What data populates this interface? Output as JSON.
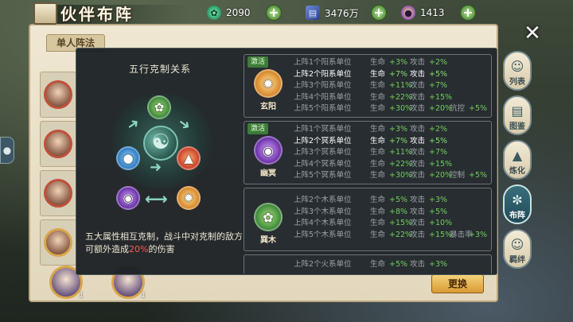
{
  "header": {
    "title": "伙伴布阵",
    "resources": [
      {
        "icon": "jade-icon",
        "value": "2090"
      },
      {
        "icon": "book-icon",
        "value": "3476万"
      },
      {
        "icon": "orb-icon",
        "value": "1413"
      }
    ]
  },
  "panel": {
    "tab_label": "单人阵法",
    "swap_button": "更换",
    "bottom_levels": [
      "1",
      "1"
    ]
  },
  "side_menu": [
    {
      "label": "列表",
      "icon": "list-icon"
    },
    {
      "label": "图鉴",
      "icon": "album-icon"
    },
    {
      "label": "炼化",
      "icon": "furnace-icon"
    },
    {
      "label": "布阵",
      "icon": "formation-icon",
      "active": true
    },
    {
      "label": "羁绊",
      "icon": "bond-icon"
    }
  ],
  "wheel": {
    "title": "五行克制关系",
    "desc_prefix": "五大属性相互克制，战斗中对克制的敌方可额外造成",
    "desc_highlight": "20%",
    "desc_suffix": "的伤害"
  },
  "cards": [
    {
      "badge": "激活",
      "name": "玄阳",
      "rows": [
        {
          "cond": "上阵1个阳系单位",
          "a_k": "生命",
          "a_v": "+3%",
          "b_k": "攻击",
          "b_v": "+2%",
          "c_k": "",
          "c_v": ""
        },
        {
          "cond": "上阵2个阳系单位",
          "a_k": "生命",
          "a_v": "+7%",
          "b_k": "攻击",
          "b_v": "+5%",
          "c_k": "",
          "c_v": "",
          "current": true
        },
        {
          "cond": "上阵3个阳系单位",
          "a_k": "生命",
          "a_v": "+11%",
          "b_k": "攻击",
          "b_v": "+7%",
          "c_k": "",
          "c_v": ""
        },
        {
          "cond": "上阵4个阳系单位",
          "a_k": "生命",
          "a_v": "+22%",
          "b_k": "攻击",
          "b_v": "+15%",
          "c_k": "",
          "c_v": ""
        },
        {
          "cond": "上阵5个阳系单位",
          "a_k": "生命",
          "a_v": "+30%",
          "b_k": "攻击",
          "b_v": "+20%",
          "c_k": "抗控",
          "c_v": "+5%"
        }
      ]
    },
    {
      "badge": "激活",
      "name": "幽冥",
      "rows": [
        {
          "cond": "上阵1个冥系单位",
          "a_k": "生命",
          "a_v": "+3%",
          "b_k": "攻击",
          "b_v": "+2%",
          "c_k": "",
          "c_v": ""
        },
        {
          "cond": "上阵2个冥系单位",
          "a_k": "生命",
          "a_v": "+7%",
          "b_k": "攻击",
          "b_v": "+5%",
          "c_k": "",
          "c_v": "",
          "current": true
        },
        {
          "cond": "上阵3个冥系单位",
          "a_k": "生命",
          "a_v": "+11%",
          "b_k": "攻击",
          "b_v": "+7%",
          "c_k": "",
          "c_v": ""
        },
        {
          "cond": "上阵4个冥系单位",
          "a_k": "生命",
          "a_v": "+22%",
          "b_k": "攻击",
          "b_v": "+15%",
          "c_k": "",
          "c_v": ""
        },
        {
          "cond": "上阵5个冥系单位",
          "a_k": "生命",
          "a_v": "+30%",
          "b_k": "攻击",
          "b_v": "+20%",
          "c_k": "控制",
          "c_v": "+5%"
        }
      ]
    },
    {
      "badge": "",
      "name": "巽木",
      "rows": [
        {
          "cond": "上阵2个木系单位",
          "a_k": "生命",
          "a_v": "+5%",
          "b_k": "攻击",
          "b_v": "+3%",
          "c_k": "",
          "c_v": ""
        },
        {
          "cond": "上阵3个木系单位",
          "a_k": "生命",
          "a_v": "+8%",
          "b_k": "攻击",
          "b_v": "+5%",
          "c_k": "",
          "c_v": ""
        },
        {
          "cond": "上阵4个木系单位",
          "a_k": "生命",
          "a_v": "+15%",
          "b_k": "攻击",
          "b_v": "+10%",
          "c_k": "",
          "c_v": ""
        },
        {
          "cond": "上阵5个木系单位",
          "a_k": "生命",
          "a_v": "+22%",
          "b_k": "攻击",
          "b_v": "+15%",
          "c_k": "暴击率",
          "c_v": "+3%"
        }
      ]
    },
    {
      "badge": "",
      "name": "",
      "rows": [
        {
          "cond": "上阵2个火系单位",
          "a_k": "生命",
          "a_v": "+5%",
          "b_k": "攻击",
          "b_v": "+3%",
          "c_k": "",
          "c_v": ""
        }
      ]
    }
  ]
}
